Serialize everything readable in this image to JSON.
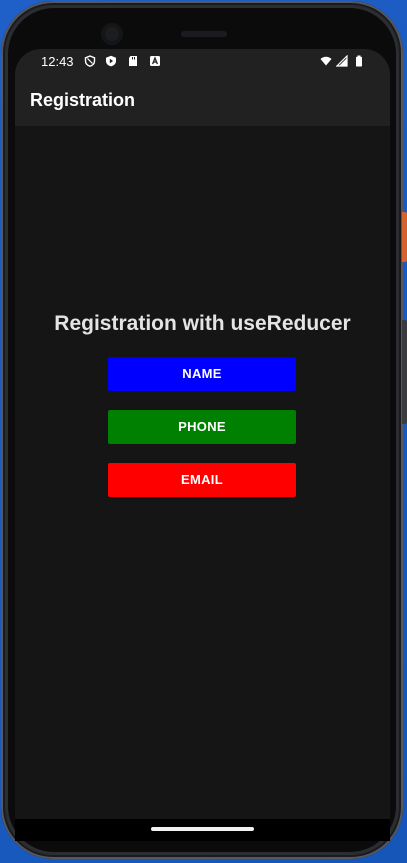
{
  "status_bar": {
    "time": "12:43",
    "left_icons": [
      "shield-icon",
      "play-protect-icon",
      "sd-card-icon",
      "accessibility-a-icon"
    ],
    "right_icons": [
      "wifi-icon",
      "signal-icon",
      "battery-icon"
    ]
  },
  "app_bar": {
    "title": "Registration"
  },
  "main": {
    "heading": "Registration with useReducer",
    "buttons": [
      {
        "label": "NAME",
        "color": "#0000ff"
      },
      {
        "label": "PHONE",
        "color": "#008000"
      },
      {
        "label": "EMAIL",
        "color": "#ff0000"
      }
    ]
  },
  "colors": {
    "background": "#151515",
    "app_bar": "#212121",
    "heading_text": "#e4e4e4"
  }
}
